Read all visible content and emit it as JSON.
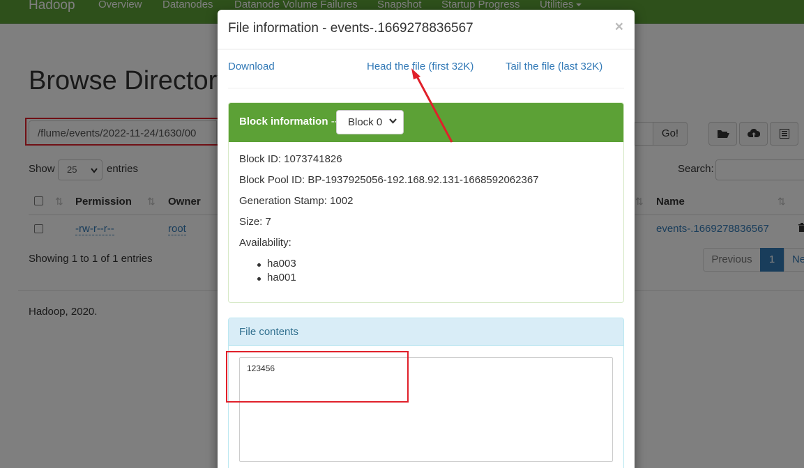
{
  "navbar": {
    "brand": "Hadoop",
    "items": [
      "Overview",
      "Datanodes",
      "Datanode Volume Failures",
      "Snapshot",
      "Startup Progress",
      "Utilities"
    ]
  },
  "page": {
    "title": "Browse Directory",
    "path_value": "/flume/events/2022-11-24/1630/00",
    "go_label": "Go!",
    "show_label": "Show",
    "entries_value": "25",
    "entries_label": "entries",
    "search_label": "Search:",
    "table": {
      "headers": [
        "Permission",
        "Owner",
        "Name"
      ],
      "rows": [
        {
          "permission": "-rw-r--r--",
          "owner": "root",
          "name": "events-.1669278836567"
        }
      ]
    },
    "showing": "Showing 1 to 1 of 1 entries",
    "pager": {
      "previous": "Previous",
      "current": "1",
      "next": "Next"
    },
    "footer": "Hadoop, 2020."
  },
  "modal": {
    "title": "File information - events-.1669278836567",
    "close": "×",
    "links": {
      "download": "Download",
      "head": "Head the file (first 32K)",
      "tail": "Tail the file (last 32K)"
    },
    "block_panel": {
      "title": "Block information",
      "dash": "--",
      "select_value": "Block 0",
      "block_id": "Block ID: 1073741826",
      "block_pool_id": "Block Pool ID: BP-1937925056-192.168.92.131-1668592062367",
      "generation_stamp": "Generation Stamp: 1002",
      "size": "Size: 7",
      "availability_label": "Availability:",
      "availability": [
        "ha003",
        "ha001"
      ]
    },
    "contents_panel": {
      "title": "File contents",
      "text": "123456"
    }
  },
  "colors": {
    "navbar": "#5ca136",
    "link": "#337ab7",
    "highlight": "#e0202a",
    "info_panel": "#d9edf7"
  },
  "icons": [
    "folder-open-icon",
    "cloud-upload-icon",
    "list-icon",
    "trash-icon",
    "sort-icon"
  ]
}
